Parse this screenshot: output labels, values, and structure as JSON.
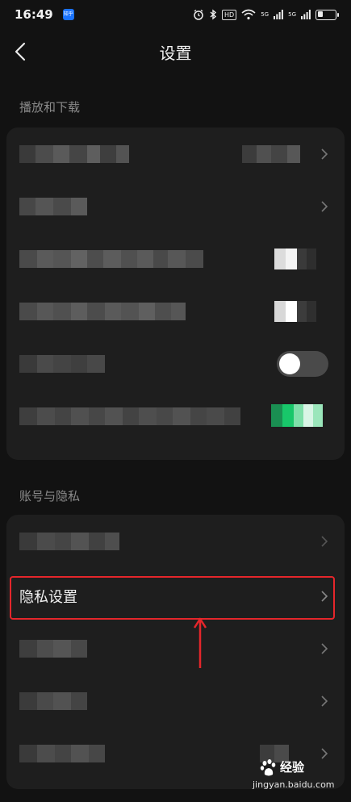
{
  "status_bar": {
    "time": "16:49",
    "app_badge": "知乎",
    "hd_label": "HD",
    "network_1": "5G",
    "network_2": "5G"
  },
  "header": {
    "title": "设置",
    "back_icon": "chevron-left-icon"
  },
  "sections": [
    {
      "label": "播放和下载"
    },
    {
      "label": "账号与隐私"
    }
  ],
  "privacy_row": {
    "label": "隐私设置"
  },
  "watermark": {
    "brand": "经验",
    "url": "jingyan.baidu.com"
  },
  "colors": {
    "background": "#121212",
    "card": "#1e1e1e",
    "toggle_off": "#4a4a4a",
    "highlight": "#e5262b",
    "accent_green": "#18c76a"
  }
}
